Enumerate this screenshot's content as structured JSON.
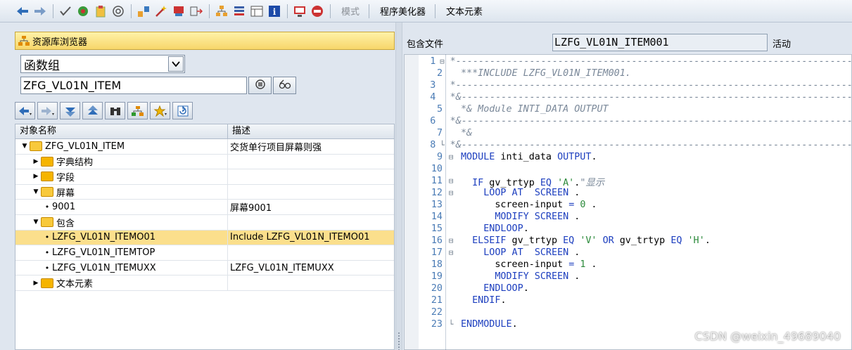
{
  "toolbar": {
    "icons": [
      "back-arrow-icon",
      "forward-arrow-icon",
      "check-icon",
      "activate-icon",
      "clipboard-icon",
      "where-used-icon",
      "display-object-list-icon",
      "hierarchy-icon",
      "wand-icon",
      "pattern-icon",
      "insert-icon",
      "tree-icon",
      "stack-icon",
      "layout-icon",
      "info-icon",
      "screen-icon",
      "stop-icon"
    ],
    "mode_label": "模式",
    "pretty_printer_label": "程序美化器",
    "text_elements_label": "文本元素"
  },
  "navigator": {
    "title": "资源库浏览器",
    "object_type": "函数组",
    "object_name": "ZFG_VL01N_ITEM",
    "columns": [
      "对象名称",
      "描述"
    ],
    "rows": [
      {
        "level": 0,
        "expand": "open",
        "kind": "folder",
        "name": "ZFG_VL01N_ITEM",
        "desc": "交货单行项目屏幕则强",
        "selected": false
      },
      {
        "level": 1,
        "expand": "closed",
        "kind": "folder",
        "name": "字典结构",
        "desc": "",
        "selected": false
      },
      {
        "level": 1,
        "expand": "closed",
        "kind": "folder",
        "name": "字段",
        "desc": "",
        "selected": false
      },
      {
        "level": 1,
        "expand": "open",
        "kind": "folder",
        "name": "屏幕",
        "desc": "",
        "selected": false
      },
      {
        "level": 2,
        "expand": "none",
        "kind": "item",
        "name": "9001",
        "desc": "屏幕9001",
        "selected": false
      },
      {
        "level": 1,
        "expand": "open",
        "kind": "folder",
        "name": "包含",
        "desc": "",
        "selected": false
      },
      {
        "level": 2,
        "expand": "none",
        "kind": "item",
        "name": "LZFG_VL01N_ITEMO01",
        "desc": "Include LZFG_VL01N_ITEMO01",
        "selected": true
      },
      {
        "level": 2,
        "expand": "none",
        "kind": "item",
        "name": "LZFG_VL01N_ITEMTOP",
        "desc": "",
        "selected": false
      },
      {
        "level": 2,
        "expand": "none",
        "kind": "item",
        "name": "LZFG_VL01N_ITEMUXX",
        "desc": "LZFG_VL01N_ITEMUXX",
        "selected": false
      },
      {
        "level": 1,
        "expand": "closed",
        "kind": "folder",
        "name": "文本元素",
        "desc": "",
        "selected": false
      }
    ]
  },
  "editor": {
    "include_label": "包含文件",
    "include_name": "LZFG_VL01N_ITEM001",
    "status": "活动",
    "lines": [
      {
        "n": "1",
        "fold": "box",
        "parts": [
          [
            "cm",
            "*----------------------------------------------------------------------"
          ]
        ]
      },
      {
        "n": "2",
        "fold": "",
        "parts": [
          [
            "cm",
            "***INCLUDE LZFG_VL01N_ITEM001."
          ]
        ]
      },
      {
        "n": "3",
        "fold": "",
        "parts": [
          [
            "cm",
            "*----------------------------------------------------------------------"
          ]
        ]
      },
      {
        "n": "4",
        "fold": "",
        "parts": [
          [
            "cm",
            "*&---------------------------------------------------------------------"
          ]
        ]
      },
      {
        "n": "5",
        "fold": "",
        "parts": [
          [
            "cm",
            "*& Module INTI_DATA OUTPUT"
          ]
        ]
      },
      {
        "n": "6",
        "fold": "",
        "parts": [
          [
            "cm",
            "*&---------------------------------------------------------------------"
          ]
        ]
      },
      {
        "n": "7",
        "fold": "",
        "parts": [
          [
            "cm",
            "*&"
          ]
        ]
      },
      {
        "n": "8",
        "fold": "end",
        "parts": [
          [
            "cm",
            "*&---------------------------------------------------------------------"
          ]
        ]
      },
      {
        "n": "9",
        "fold": "box",
        "parts": [
          [
            "kw",
            "MODULE"
          ],
          [
            "tx",
            " inti_data "
          ],
          [
            "kw",
            "OUTPUT"
          ],
          [
            "tx",
            "."
          ]
        ]
      },
      {
        "n": "10",
        "fold": "",
        "parts": []
      },
      {
        "n": "11",
        "fold": "box",
        "parts": [
          [
            "tx",
            "  "
          ],
          [
            "kw",
            "IF"
          ],
          [
            "tx",
            " gv_trtyp "
          ],
          [
            "kw",
            "EQ"
          ],
          [
            "tx",
            " "
          ],
          [
            "st",
            "'A'"
          ],
          [
            "tx",
            "."
          ],
          [
            "cm",
            "\"显示"
          ]
        ]
      },
      {
        "n": "12",
        "fold": "box",
        "parts": [
          [
            "tx",
            "    "
          ],
          [
            "kw",
            "LOOP AT"
          ],
          [
            "tx",
            "  "
          ],
          [
            "kw",
            "SCREEN"
          ],
          [
            "tx",
            " ."
          ]
        ]
      },
      {
        "n": "13",
        "fold": "",
        "parts": [
          [
            "tx",
            "      screen-input "
          ],
          [
            "kw",
            "="
          ],
          [
            "tx",
            " "
          ],
          [
            "nm",
            "0"
          ],
          [
            "tx",
            " ."
          ]
        ]
      },
      {
        "n": "14",
        "fold": "",
        "parts": [
          [
            "tx",
            "      "
          ],
          [
            "kw",
            "MODIFY SCREEN"
          ],
          [
            "tx",
            " ."
          ]
        ]
      },
      {
        "n": "15",
        "fold": "",
        "parts": [
          [
            "tx",
            "    "
          ],
          [
            "kw",
            "ENDLOOP"
          ],
          [
            "tx",
            "."
          ]
        ]
      },
      {
        "n": "16",
        "fold": "box",
        "parts": [
          [
            "tx",
            "  "
          ],
          [
            "kw",
            "ELSEIF"
          ],
          [
            "tx",
            " gv_trtyp "
          ],
          [
            "kw",
            "EQ"
          ],
          [
            "tx",
            " "
          ],
          [
            "st",
            "'V'"
          ],
          [
            "tx",
            " "
          ],
          [
            "kw",
            "OR"
          ],
          [
            "tx",
            " gv_trtyp "
          ],
          [
            "kw",
            "EQ"
          ],
          [
            "tx",
            " "
          ],
          [
            "st",
            "'H'"
          ],
          [
            "tx",
            "."
          ]
        ]
      },
      {
        "n": "17",
        "fold": "box",
        "parts": [
          [
            "tx",
            "    "
          ],
          [
            "kw",
            "LOOP AT"
          ],
          [
            "tx",
            "  "
          ],
          [
            "kw",
            "SCREEN"
          ],
          [
            "tx",
            " ."
          ]
        ]
      },
      {
        "n": "18",
        "fold": "",
        "parts": [
          [
            "tx",
            "      screen-input "
          ],
          [
            "kw",
            "="
          ],
          [
            "tx",
            " "
          ],
          [
            "nm",
            "1"
          ],
          [
            "tx",
            " ."
          ]
        ]
      },
      {
        "n": "19",
        "fold": "",
        "parts": [
          [
            "tx",
            "      "
          ],
          [
            "kw",
            "MODIFY SCREEN"
          ],
          [
            "tx",
            " ."
          ]
        ]
      },
      {
        "n": "20",
        "fold": "",
        "parts": [
          [
            "tx",
            "    "
          ],
          [
            "kw",
            "ENDLOOP"
          ],
          [
            "tx",
            "."
          ]
        ]
      },
      {
        "n": "21",
        "fold": "",
        "parts": [
          [
            "tx",
            "  "
          ],
          [
            "kw",
            "ENDIF"
          ],
          [
            "tx",
            "."
          ]
        ]
      },
      {
        "n": "22",
        "fold": "",
        "parts": []
      },
      {
        "n": "23",
        "fold": "end",
        "parts": [
          [
            "kw",
            "ENDMODULE"
          ],
          [
            "tx",
            "."
          ]
        ]
      }
    ]
  },
  "watermark": "CSDN @weixin_49689040",
  "colors": {
    "keyword": "#1d3fbf",
    "comment": "#7a8899",
    "string": "#2c8a3b",
    "selection": "#fbdf8c",
    "title_bar": "#f7d66a"
  }
}
